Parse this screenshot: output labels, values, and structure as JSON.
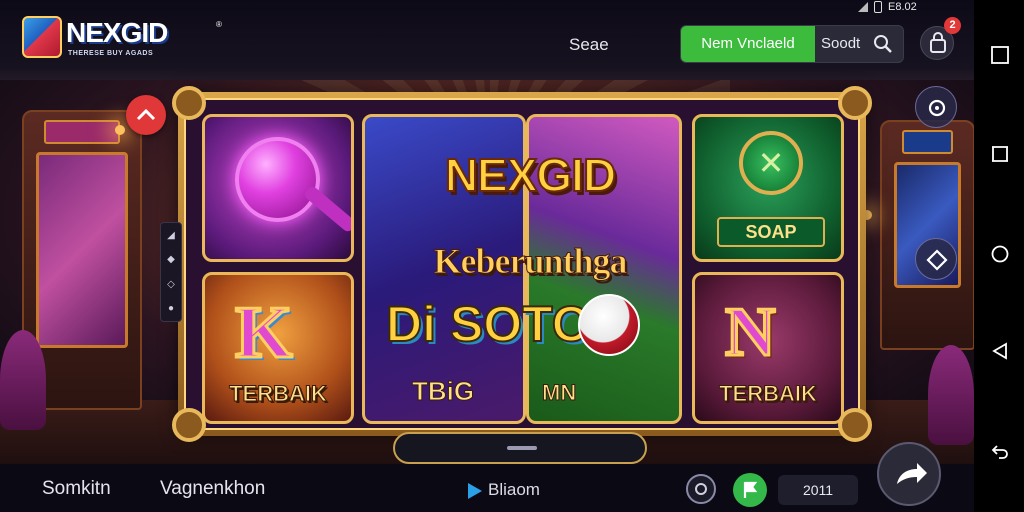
{
  "brand": {
    "name": "NEXGID",
    "tagline": "THERESE BUY AGADS",
    "registered": "®"
  },
  "header": {
    "nav_label": "Seae",
    "cta_label": "Nem Vnclaeld",
    "search_text": "Soodt",
    "cart_badge": "2"
  },
  "status_bar": {
    "text": "E8.02"
  },
  "banner": {
    "title": "NEXGID",
    "subtitle": "Keberunthga",
    "slot_line": "Di SOTO",
    "tiles": [
      {
        "id": "gem",
        "label": ""
      },
      {
        "id": "k",
        "letter": "K",
        "label": "TERBAIK"
      },
      {
        "id": "center",
        "label": "TBiG"
      },
      {
        "id": "mn",
        "label": "MN"
      },
      {
        "id": "soap",
        "label": "SOAP"
      },
      {
        "id": "n",
        "letter": "N",
        "label": "TERBAIK"
      }
    ]
  },
  "footer": {
    "items": [
      "Somkitn",
      "Vagnenkhon"
    ],
    "rec_label": "Bliaom",
    "counter": "2011"
  },
  "colors": {
    "accent_green": "#3cbb3c",
    "badge_red": "#e23838",
    "gold": "#e8b85a"
  }
}
